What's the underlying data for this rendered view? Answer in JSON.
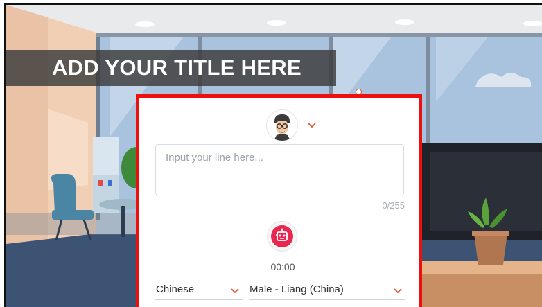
{
  "scene": {
    "title": "ADD YOUR TITLE HERE"
  },
  "editor": {
    "avatar_icon": "character-avatar-icon",
    "input_placeholder": "Input your line here...",
    "input_value": "",
    "char_counter": "0/255",
    "record_icon": "robot-tts-icon",
    "timer": "00:00",
    "language": "Chinese",
    "voice": "Male - Liang (China)"
  },
  "colors": {
    "highlight_border": "#ee0f0f",
    "accent": "#e8502a",
    "record": "#e8264f"
  }
}
